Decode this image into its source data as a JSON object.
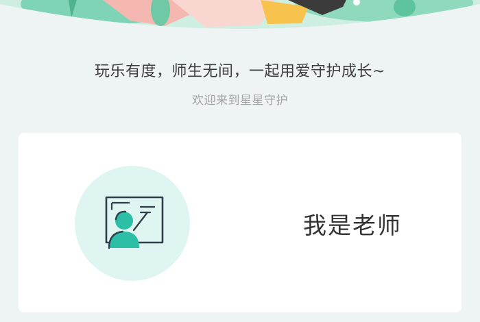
{
  "header": {
    "illustration": "teacher-and-student-banner-illustration"
  },
  "intro": {
    "slogan": "玩乐有度，师生无间，一起用爱守护成长~",
    "welcome": "欢迎来到星星守护"
  },
  "roles": [
    {
      "label": "我是老师",
      "icon": "teacher-blackboard-icon"
    }
  ],
  "colors": {
    "background": "#eef4f3",
    "card": "#ffffff",
    "accent": "#2dbfa5",
    "icon_bg": "#dff5f2",
    "text_primary": "#333333",
    "text_secondary": "#a5a5a5"
  }
}
